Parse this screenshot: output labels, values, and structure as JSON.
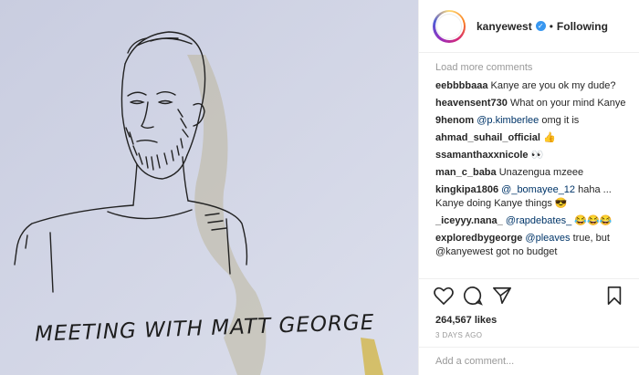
{
  "post": {
    "username": "kanyewest",
    "follow_status": "Following",
    "dot": "•",
    "verified_mark": "✓",
    "image_caption_drawn": "MEETING WITH MATT GEORGE"
  },
  "comments_panel": {
    "load_more": "Load more comments",
    "comments": [
      {
        "user": "eebbbbaaa",
        "mention": "",
        "text": "Kanye are you ok my dude?",
        "emoji": ""
      },
      {
        "user": "heavensent730",
        "mention": "",
        "text": "What on your mind Kanye",
        "emoji": ""
      },
      {
        "user": "9henom",
        "mention": "@p.kimberlee",
        "text": "omg it is",
        "emoji": ""
      },
      {
        "user": "ahmad_suhail_official",
        "mention": "",
        "text": "",
        "emoji": "👍"
      },
      {
        "user": "ssamanthaxxnicole",
        "mention": "",
        "text": "",
        "emoji": "👀"
      },
      {
        "user": "man_c_baba",
        "mention": "",
        "text": "Unazengua mzeee",
        "emoji": ""
      },
      {
        "user": "kingkipa1806",
        "mention": "@_bomayee_12",
        "text": "haha ... Kanye doing Kanye things",
        "emoji": "😎"
      },
      {
        "user": "_iceyyy.nana_",
        "mention": "@rapdebates_",
        "text": "",
        "emoji": "😂😂😂"
      },
      {
        "user": "exploredbygeorge",
        "mention": "@pleaves",
        "text": "true, but @kanyewest got no budget",
        "emoji": ""
      }
    ]
  },
  "actions": {
    "like_icon": "heart-icon",
    "comment_icon": "speech-bubble-icon",
    "share_icon": "paper-plane-icon",
    "save_icon": "bookmark-icon"
  },
  "likes": "264,567 likes",
  "time_ago": "3 DAYS AGO",
  "add_comment_placeholder": "Add a comment..."
}
